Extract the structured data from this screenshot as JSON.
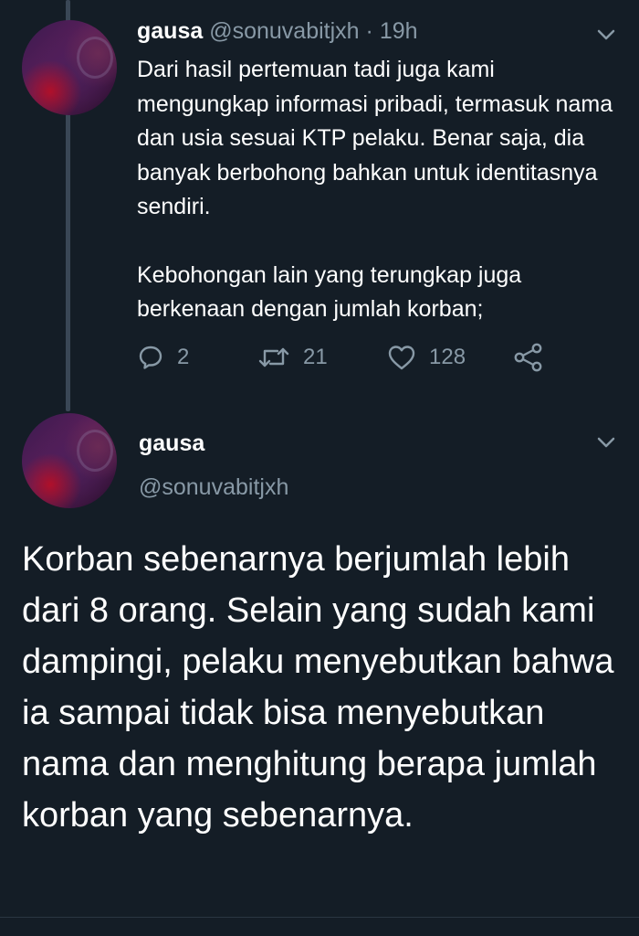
{
  "tweet1": {
    "name": "gausa",
    "handle": "@sonuvabitjxh",
    "separator": "·",
    "time": "19h",
    "paragraph1": "Dari hasil pertemuan tadi juga kami mengungkap informasi pribadi, termasuk nama dan usia sesuai KTP pelaku. Benar saja, dia banyak berbohong bahkan untuk identitasnya sendiri.",
    "paragraph2": "Kebohongan lain yang terungkap juga berkenaan dengan jumlah korban;",
    "replies": "2",
    "retweets": "21",
    "likes": "128",
    "icons": {
      "reply": "reply-icon",
      "retweet": "retweet-icon",
      "like": "heart-icon",
      "share": "share-icon",
      "menu": "chevron-down-icon"
    }
  },
  "tweet2": {
    "name": "gausa",
    "handle": "@sonuvabitjxh",
    "body": "Korban sebenarnya berjumlah lebih dari 8 orang. Selain yang sudah kami dampingi, pelaku menyebutkan bahwa ia sampai tidak bisa menyebutkan nama dan menghitung berapa jumlah korban yang sebenarnya.",
    "icons": {
      "menu": "chevron-down-icon"
    }
  },
  "colors": {
    "background": "#141d26",
    "text_primary": "#ffffff",
    "text_secondary": "#8899a6",
    "thread_line": "#3a4756"
  }
}
